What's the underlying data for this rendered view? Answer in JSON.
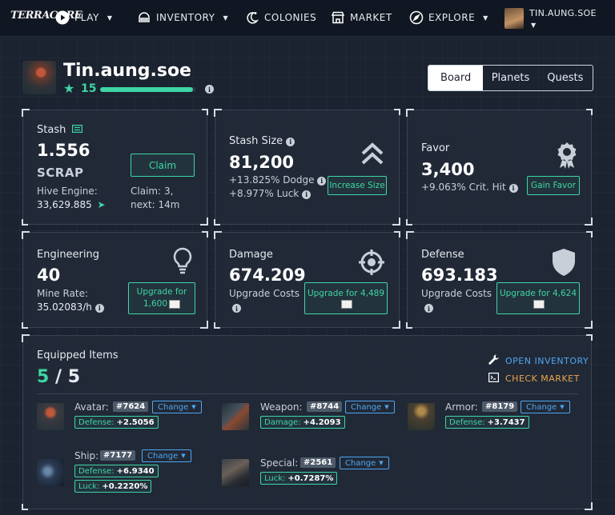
{
  "nav": {
    "logo": "TERRACORE",
    "items": [
      {
        "label": "PLAY",
        "icon": "play-icon",
        "caret": true
      },
      {
        "label": "INVENTORY",
        "icon": "helmet-icon",
        "caret": true
      },
      {
        "label": "COLONIES",
        "icon": "moon-icon",
        "caret": false
      },
      {
        "label": "MARKET",
        "icon": "store-icon",
        "caret": false
      },
      {
        "label": "EXPLORE",
        "icon": "compass-icon",
        "caret": true
      }
    ],
    "user": "TIN.AUNG.SOE"
  },
  "profile": {
    "name": "Tin.aung.soe",
    "level": "15",
    "xp_fraction": 0.97
  },
  "tabs": [
    "Board",
    "Planets",
    "Quests"
  ],
  "stash": {
    "title": "Stash",
    "amount": "1.556",
    "unit": "SCRAP",
    "hive_label": "Hive Engine:",
    "hive_value": "33,629.885",
    "claim_button": "Claim",
    "claim_info": "Claim: 3,",
    "claim_next": "next: 14m"
  },
  "stash_size": {
    "title": "Stash Size",
    "value": "81,200",
    "dodge": "+13.825% Dodge",
    "luck": "+8.977% Luck",
    "button": "Increase Size"
  },
  "favor": {
    "title": "Favor",
    "value": "3,400",
    "crit": "+9.063% Crit. Hit",
    "button": "Gain Favor"
  },
  "engineering": {
    "title": "Engineering",
    "value": "40",
    "rate_label": "Mine Rate:",
    "rate_value": "35.02083/h",
    "button_prefix": "Upgrade for",
    "cost": "1,600"
  },
  "damage": {
    "title": "Damage",
    "value": "674.209",
    "costs_label": "Upgrade Costs",
    "button_prefix": "Upgrade for",
    "cost": "4,489"
  },
  "defense": {
    "title": "Defense",
    "value": "693.183",
    "costs_label": "Upgrade Costs",
    "button_prefix": "Upgrade for",
    "cost": "4,624"
  },
  "equipped": {
    "title": "Equipped Items",
    "current": "5",
    "sep": "/",
    "total": "5",
    "open_inventory": "OPEN INVENTORY",
    "check_market": "CHECK MARKET",
    "change_label": "Change",
    "items": [
      {
        "label": "Avatar:",
        "id": "#7624",
        "stats": [
          {
            "name": "Defense:",
            "value": "+2.5056"
          }
        ]
      },
      {
        "label": "Weapon:",
        "id": "#8744",
        "stats": [
          {
            "name": "Damage:",
            "value": "+4.2093"
          }
        ]
      },
      {
        "label": "Armor:",
        "id": "#8179",
        "stats": [
          {
            "name": "Defense:",
            "value": "+3.7437"
          }
        ]
      },
      {
        "label": "Ship:",
        "id": "#7177",
        "stats": [
          {
            "name": "Defense:",
            "value": "+6.9340"
          },
          {
            "name": "Luck:",
            "value": "+0.2220%"
          }
        ]
      },
      {
        "label": "Special:",
        "id": "#2561",
        "stats": [
          {
            "name": "Luck:",
            "value": "+0.7287%"
          }
        ]
      }
    ]
  },
  "colors": {
    "accent_green": "#3ed6a4",
    "accent_blue": "#4ea6f0",
    "accent_orange": "#e8a64a",
    "background": "#1b2230"
  }
}
